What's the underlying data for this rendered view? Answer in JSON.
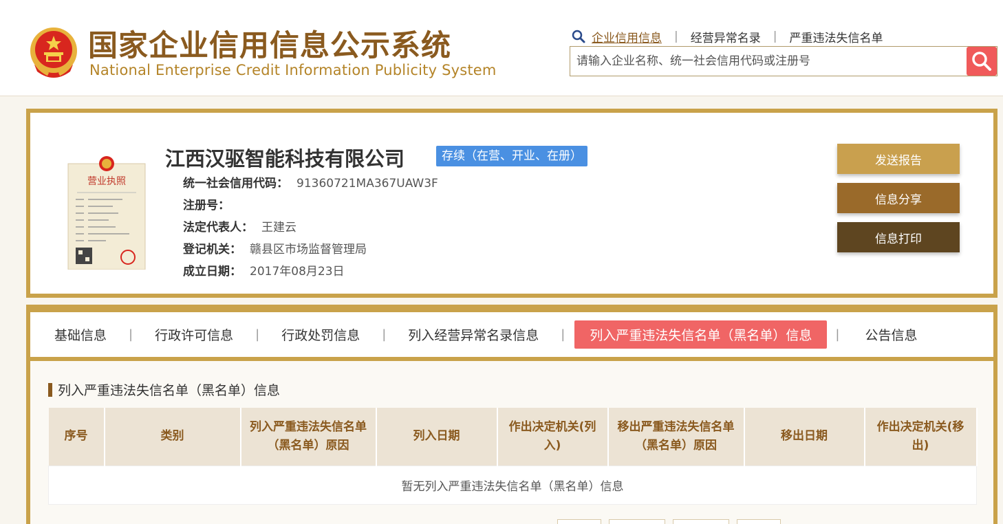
{
  "header": {
    "logo_cn": "国家企业信用信息公示系统",
    "logo_en": "National Enterprise Credit Information Publicity System",
    "nav": [
      {
        "label": "企业信用信息",
        "active": true
      },
      {
        "label": "经营异常名录",
        "active": false
      },
      {
        "label": "严重违法失信名单",
        "active": false
      }
    ],
    "search_placeholder": "请输入企业名称、统一社会信用代码或注册号"
  },
  "company": {
    "name": "江西汉驱智能科技有限公司",
    "status": "存续（在营、开业、在册）",
    "license_title": "营业执照",
    "fields": [
      {
        "label": "统一社会信用代码：",
        "value": "91360721MA367UAW3F"
      },
      {
        "label": "注册号：",
        "value": ""
      },
      {
        "label": "法定代表人：",
        "value": "王建云"
      },
      {
        "label": "登记机关：",
        "value": "赣县区市场监督管理局"
      },
      {
        "label": "成立日期：",
        "value": "2017年08月23日"
      }
    ],
    "actions": [
      "发送报告",
      "信息分享",
      "信息打印"
    ]
  },
  "tabs": [
    {
      "label": "基础信息",
      "active": false
    },
    {
      "label": "行政许可信息",
      "active": false
    },
    {
      "label": "行政处罚信息",
      "active": false
    },
    {
      "label": "列入经营异常名录信息",
      "active": false
    },
    {
      "label": "列入严重违法失信名单（黑名单）信息",
      "active": true
    },
    {
      "label": "公告信息",
      "active": false
    }
  ],
  "section": {
    "title": "列入严重违法失信名单（黑名单）信息",
    "columns": [
      "序号",
      "类别",
      "列入严重违法失信名单（黑名单）原因",
      "列入日期",
      "作出决定机关(列入)",
      "移出严重违法失信名单（黑名单）原因",
      "移出日期",
      "作出决定机关(移出)"
    ],
    "empty_text": "暂无列入严重违法失信名单（黑名单）信息"
  },
  "colors": {
    "gold_border": "#c9a24a",
    "brown_text": "#8a5a1f",
    "status_blue": "#4a90e2",
    "active_tab_red": "#f06565",
    "search_red": "#f05a5a"
  }
}
